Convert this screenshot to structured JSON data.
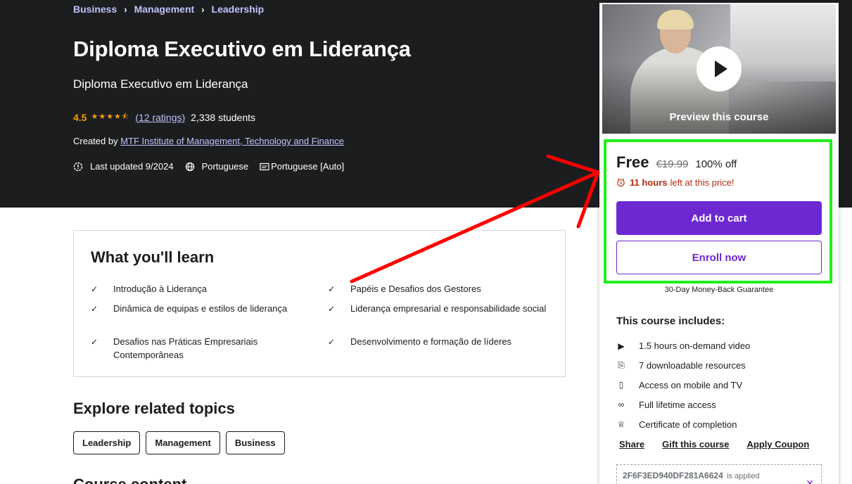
{
  "breadcrumb": {
    "items": [
      "Business",
      "Management",
      "Leadership"
    ],
    "separator": "›"
  },
  "course": {
    "title": "Diploma Executivo em Liderança",
    "subtitle": "Diploma Executivo em Liderança",
    "rating": "4.5",
    "stars_text": "★★★★⯪",
    "ratings_count": "(12 ratings)",
    "students": "2,338 students",
    "created_by_label": "Created by",
    "instructor": "MTF Institute of Management, Technology and Finance",
    "last_updated": "Last updated 9/2024",
    "language": "Portuguese",
    "captions": "Portuguese [Auto]"
  },
  "learn": {
    "title": "What you'll learn",
    "items": [
      "Introdução à Liderança",
      "Papéis e Desafios dos Gestores",
      "Dinâmica de equipas e estilos de liderança",
      "Liderança empresarial e responsabilidade social",
      "Desafios nas Práticas Empresariais Contemporâneas",
      "Desenvolvimento e formação de líderes"
    ]
  },
  "topics": {
    "title": "Explore related topics",
    "items": [
      "Leadership",
      "Management",
      "Business"
    ]
  },
  "next_section": {
    "title": "Course content"
  },
  "sidebar": {
    "preview_label": "Preview this course",
    "price": "Free",
    "original_price": "€19.99",
    "discount": "100% off",
    "timer_bold": "11 hours",
    "timer_text": "left at this price!",
    "add_to_cart": "Add to cart",
    "enroll_now": "Enroll now",
    "guarantee": "30-Day Money-Back Guarantee",
    "includes_title": "This course includes:",
    "includes": [
      {
        "icon": "video-icon",
        "glyph": "▶",
        "text": "1.5 hours on-demand video"
      },
      {
        "icon": "file-download-icon",
        "glyph": "⎘",
        "text": "7 downloadable resources"
      },
      {
        "icon": "mobile-icon",
        "glyph": "▯",
        "text": "Access on mobile and TV"
      },
      {
        "icon": "infinity-icon",
        "glyph": "∞",
        "text": "Full lifetime access"
      },
      {
        "icon": "trophy-icon",
        "glyph": "♕",
        "text": "Certificate of completion"
      }
    ],
    "links": [
      "Share",
      "Gift this course",
      "Apply Coupon"
    ],
    "coupon_code": "2F6F3ED940DF281A6624",
    "coupon_status": "is applied"
  },
  "colors": {
    "hero_bg": "#1c1d1f",
    "link": "#c0c4fc",
    "star": "#f69c08",
    "primary": "#6d28d2",
    "timer": "#b32d0f",
    "highlight_box": "#1ff01a",
    "arrow": "#ff0000"
  }
}
